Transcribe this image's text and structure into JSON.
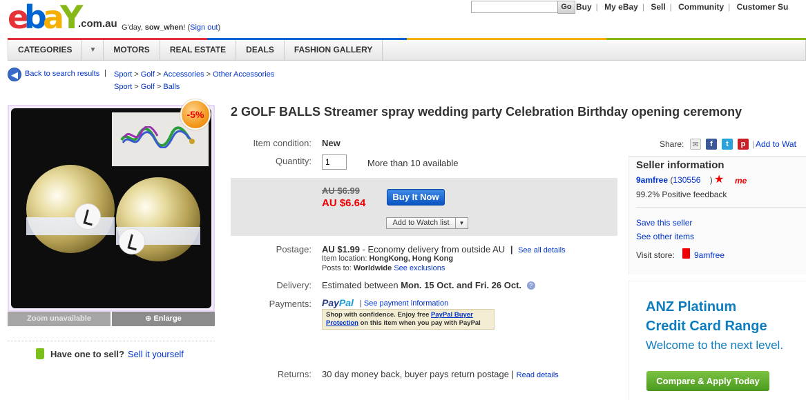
{
  "header": {
    "logo_text": "ebay",
    "logo_suffix": ".com.au",
    "greeting_prefix": "G'day,",
    "username": "sow_when",
    "greeting_suffix": "!",
    "sign_out_open": "(",
    "sign_out": "Sign out",
    "sign_out_close": ")",
    "search_value": "",
    "go_button": "Go",
    "links": [
      "Buy",
      "My eBay",
      "Sell",
      "Community",
      "Customer Su"
    ]
  },
  "nav": {
    "categories": "CATEGORIES",
    "items": [
      "MOTORS",
      "REAL ESTATE",
      "DEALS",
      "FASHION GALLERY"
    ]
  },
  "breadcrumbs": {
    "back": "Back to search results",
    "separator": "|",
    "path1": [
      "Sport",
      "Golf",
      "Accessories",
      "Other Accessories"
    ],
    "path2": [
      "Sport",
      "Golf",
      "Balls"
    ],
    "crumb_sep": ">"
  },
  "image_panel": {
    "discount_badge": "-5%",
    "zoom_unavailable": "Zoom unavailable",
    "enlarge": "Enlarge",
    "have_one": "Have one to sell?",
    "sell_it": "Sell it yourself"
  },
  "item": {
    "title": "2 GOLF BALLS Streamer spray wedding party Celebration Birthday opening ceremony",
    "condition_label": "Item condition:",
    "condition": "New",
    "quantity_label": "Quantity:",
    "quantity_value": "1",
    "available": "More than 10 available",
    "original_price": "AU $6.99",
    "price": "AU $6.64",
    "buy_now": "Buy It Now",
    "add_to_watch": "Add to Watch list",
    "postage_label": "Postage:",
    "postage_price": "AU $1.99",
    "postage_desc": "- Economy delivery from outside AU",
    "pipe": "|",
    "see_all_details": "See all details",
    "item_location_label": "Item location:",
    "item_location": "HongKong, Hong Kong",
    "posts_to_label": "Posts to:",
    "posts_to": "Worldwide",
    "see_exclusions": "See exclusions",
    "delivery_label": "Delivery:",
    "delivery_prefix": "Estimated between",
    "delivery_dates": "Mon. 15 Oct. and Fri. 26 Oct.",
    "payments_label": "Payments:",
    "paypal_logo_1": "Pay",
    "paypal_logo_2": "Pal",
    "see_payment_info": "See payment information",
    "pp_shop": "Shop with confidence. Enjoy free",
    "pp_link": "PayPal Buyer Protection",
    "pp_tail": "on this item when you pay with PayPal",
    "returns_label": "Returns:",
    "returns": "30 day money back, buyer pays return postage",
    "read_details": "Read details"
  },
  "sidebar": {
    "share": "Share:",
    "add_to_watch": "Add to Wat",
    "seller_heading": "Seller information",
    "seller_name": "9amfree",
    "seller_score_open": "(",
    "seller_score": "130556",
    "seller_score_close": ")",
    "me_badge": "me",
    "feedback": "99.2% Positive feedback",
    "save_seller": "Save this seller",
    "other_items": "See other items",
    "visit_store": "Visit store:",
    "store_name": "9amfree"
  },
  "ad": {
    "line1": "ANZ Platinum",
    "line2": "Credit Card Range",
    "line3": "Welcome to the next level.",
    "button": "Compare & Apply Today"
  },
  "colors": {
    "link": "#0033cc",
    "price": "#ee0000",
    "buy_now": "#1560c9",
    "ad_blue": "#0d7dc1",
    "ad_green": "#5dab2a"
  }
}
